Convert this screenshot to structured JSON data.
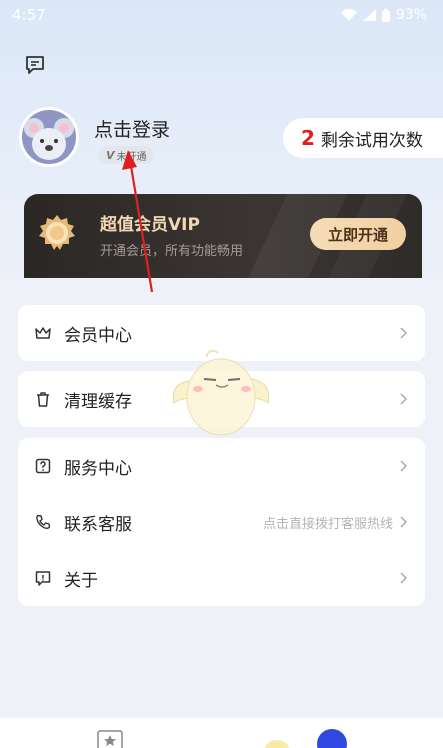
{
  "status_bar": {
    "time": "4:57",
    "battery": "93%"
  },
  "profile": {
    "login_text": "点击登录",
    "vip_badge_v": "V",
    "vip_badge_text": "未开通"
  },
  "trial": {
    "count": "2",
    "label": "剩余试用次数"
  },
  "vip_card": {
    "title": "超值会员VIP",
    "subtitle": "开通会员，所有功能畅用",
    "button": "立即开通"
  },
  "menu": {
    "member_center": "会员中心",
    "clear_cache": "清理缓存",
    "service_center": "服务中心",
    "contact": "联系客服",
    "contact_hint": "点击直接拨打客服热线",
    "about": "关于"
  },
  "colors": {
    "accent_red": "#e02020",
    "vip_gold": "#f1d7b3",
    "bg": "#eef2f8"
  }
}
